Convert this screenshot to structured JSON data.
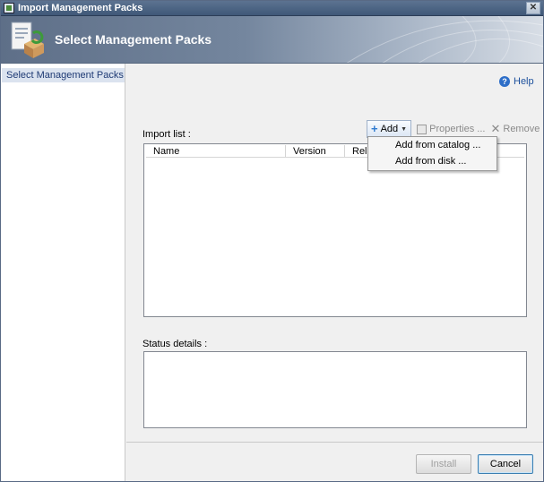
{
  "window": {
    "title": "Import Management Packs",
    "close_glyph": "✕"
  },
  "banner": {
    "title": "Select Management Packs",
    "icon": "management-pack-icon"
  },
  "nav": {
    "items": [
      {
        "label": "Select Management Packs",
        "selected": true
      }
    ]
  },
  "help": {
    "label": "Help",
    "icon_glyph": "?"
  },
  "import": {
    "label": "Import list :",
    "toolbar": {
      "add_label": "Add",
      "properties_label": "Properties ...",
      "remove_label": "Remove"
    },
    "columns": [
      "Name",
      "Version",
      "Release"
    ]
  },
  "add_menu": {
    "items": [
      "Add from catalog ...",
      "Add from disk ..."
    ]
  },
  "status": {
    "label": "Status details :"
  },
  "buttons": {
    "install": "Install",
    "cancel": "Cancel"
  },
  "colors": {
    "banner_start": "#5e6f88",
    "title_bar": "#4a6285",
    "selection": "#dbe3ef",
    "link": "#1b4f9c"
  }
}
